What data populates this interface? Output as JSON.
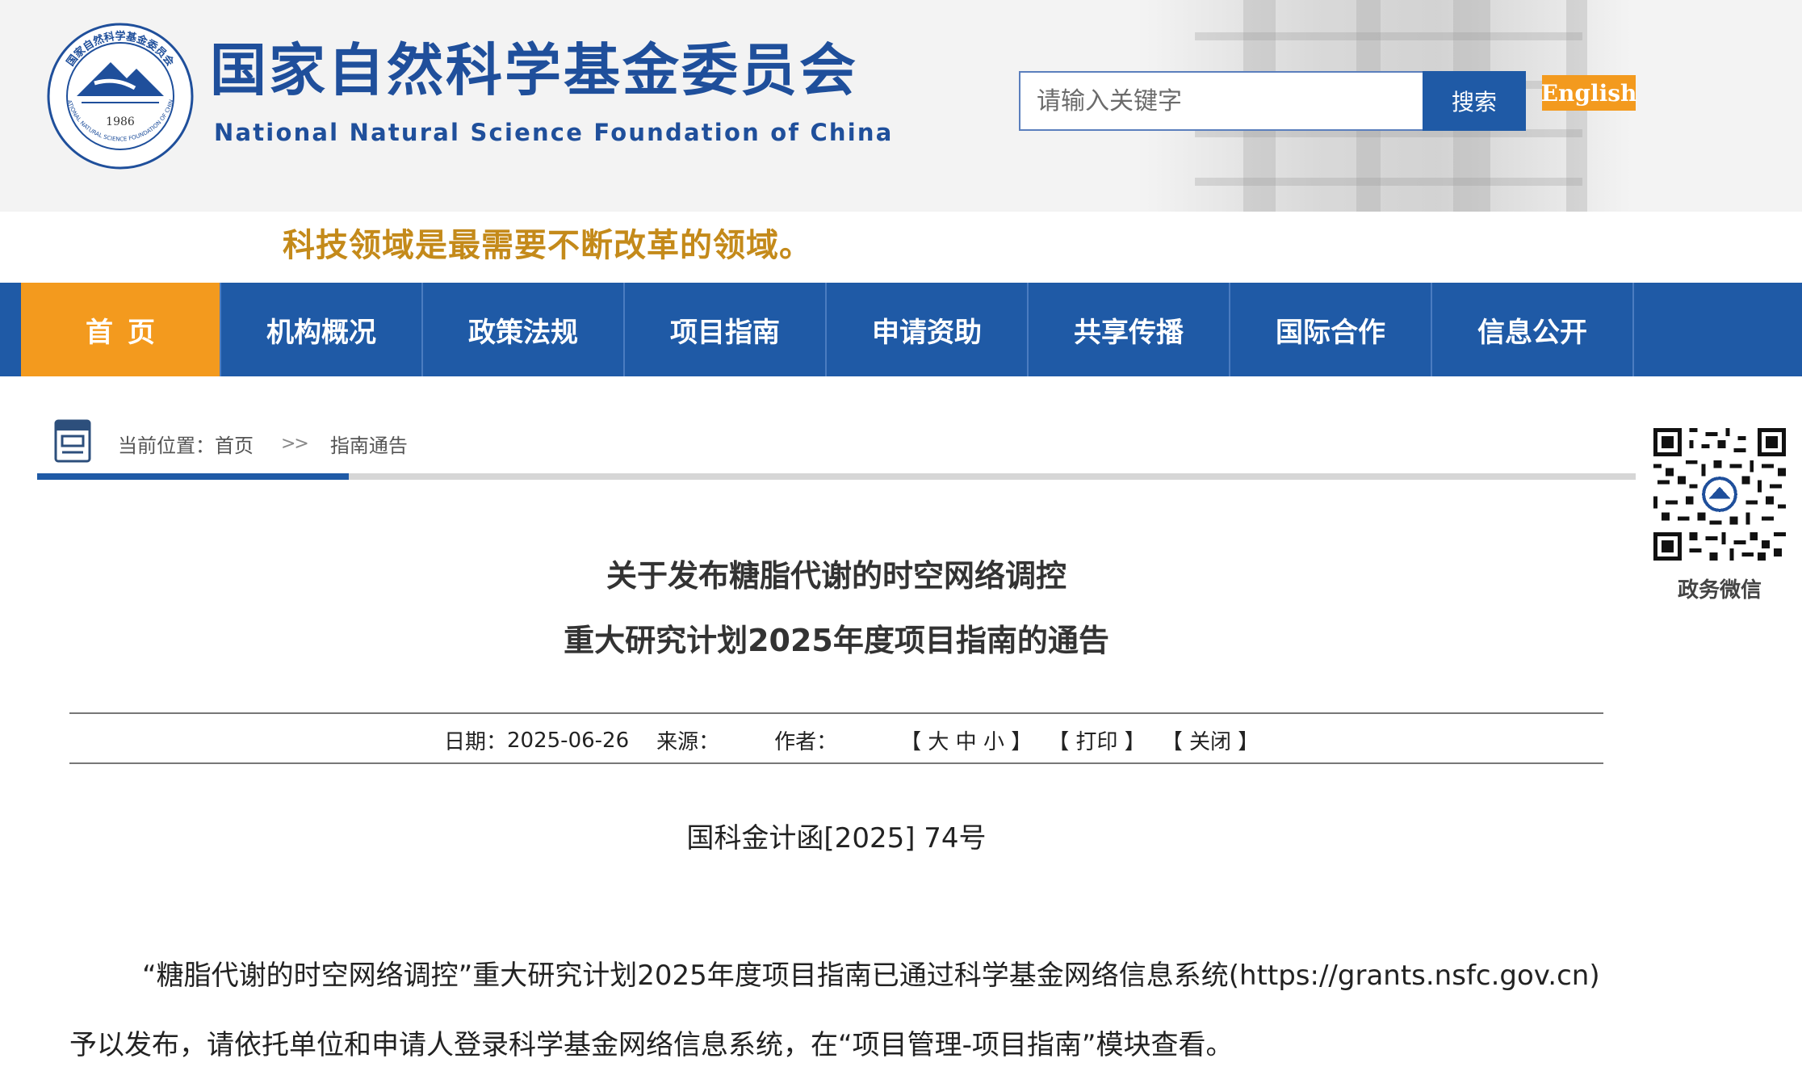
{
  "header": {
    "title_cn": "国家自然科学基金委员会",
    "title_en": "National Natural Science Foundation of China",
    "seal_text": "国家自然科学基金委员会",
    "seal_year": "1986",
    "seal_text_en": "NATIONAL NATURAL SCIENCE FOUNDATION OF CHINA",
    "search_placeholder": "请输入关键字",
    "search_label": "搜索",
    "english_label": "English"
  },
  "slogan": "科技领域是最需要不断改革的领域。",
  "nav": {
    "items": [
      {
        "label": "首页"
      },
      {
        "label": "机构概况"
      },
      {
        "label": "政策法规"
      },
      {
        "label": "项目指南"
      },
      {
        "label": "申请资助"
      },
      {
        "label": "共享传播"
      },
      {
        "label": "国际合作"
      },
      {
        "label": "信息公开"
      }
    ]
  },
  "breadcrumb": {
    "prefix": "当前位置：",
    "home": "首页",
    "separator": ">>",
    "current": "指南通告"
  },
  "qr": {
    "label": "政务微信"
  },
  "article": {
    "title_line1": "关于发布糖脂代谢的时空网络调控",
    "title_line2": "重大研究计划2025年度项目指南的通告",
    "date_label": "日期：",
    "date": "2025-06-26",
    "source_label": "来源：",
    "author_label": "作者：",
    "size_control": "【 大 中 小 】",
    "print_control": "【 打印 】",
    "close_control": "【 关闭 】",
    "doc_number": "国科金计函[2025] 74号",
    "para1": "“糖脂代谢的时空网络调控”重大研究计划2025年度项目指南已通过科学基金网络信息系统(https://grants.nsfc.gov.cn)",
    "para2": "予以发布，请依托单位和申请人登录科学基金网络信息系统，在“项目管理-项目指南”模块查看。"
  },
  "colors": {
    "brand_blue": "#1f5aa6",
    "accent_orange": "#f39a1e",
    "slogan_gold": "#c48a1a"
  }
}
